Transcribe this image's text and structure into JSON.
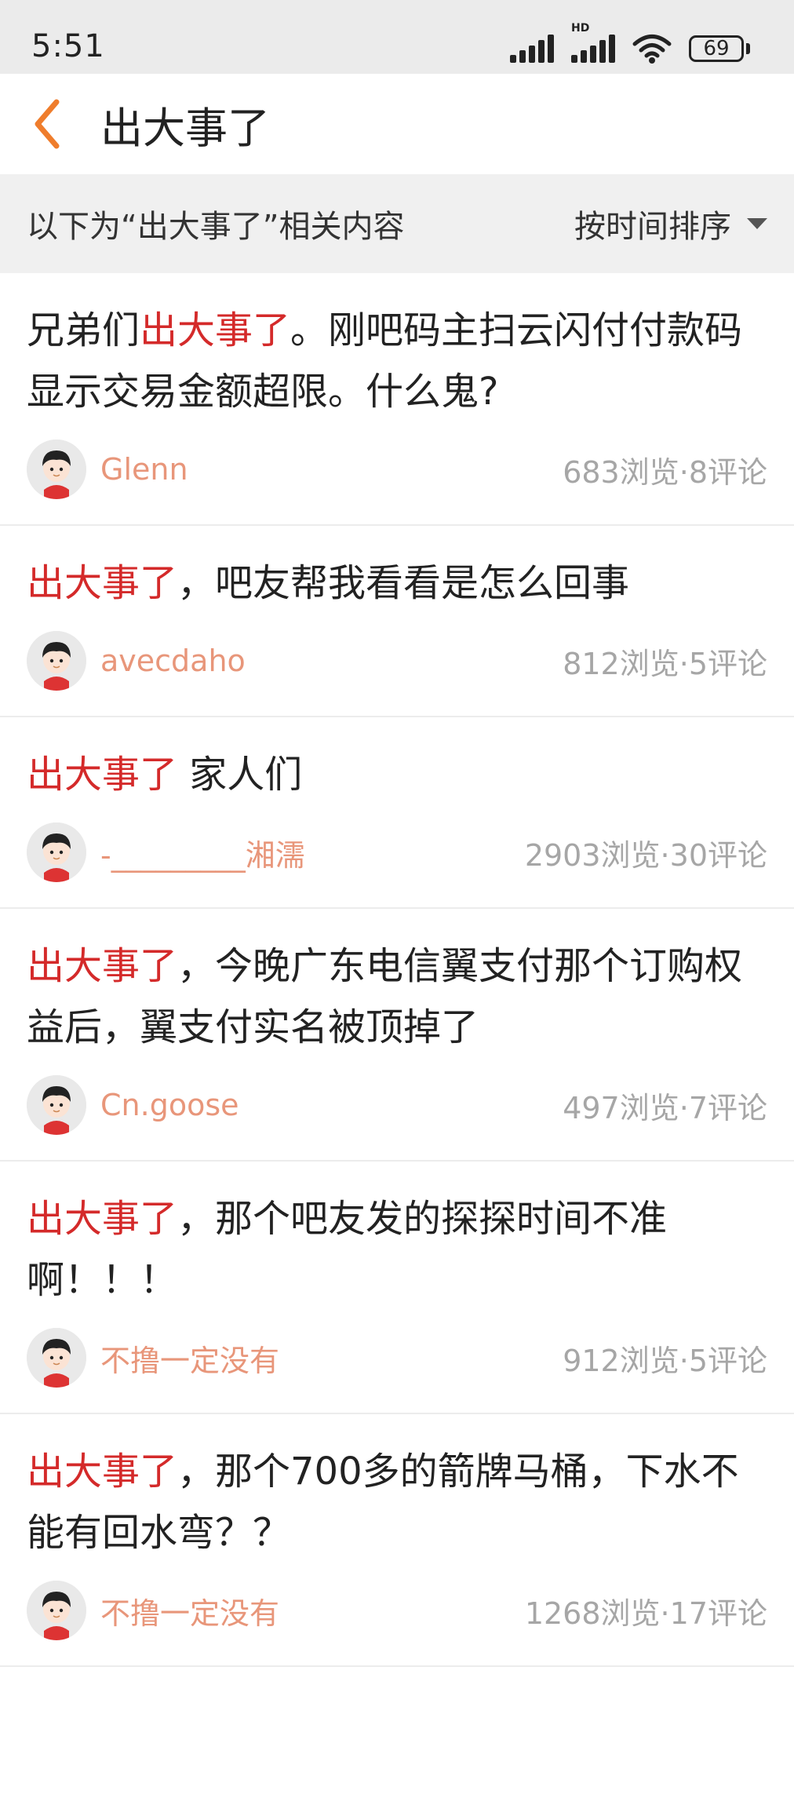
{
  "status_bar": {
    "time": "5:51",
    "battery": "69",
    "icons": [
      "signal-icon",
      "hd-signal-icon",
      "wifi-icon",
      "battery-icon"
    ]
  },
  "nav": {
    "title": "出大事了",
    "back_icon": "chevron-left-icon",
    "accent": "#ef7d2c"
  },
  "filter": {
    "label": "以下为“出大事了”相关内容",
    "sort_label": "按时间排序",
    "sort_icon": "caret-down-icon"
  },
  "keyword_color": "#d42a2a",
  "posts": [
    {
      "title_pre": "兄弟们",
      "keyword": "出大事了",
      "title_post": "。刚吧码主扫云闪付付款码 显示交易金额超限。什么鬼?",
      "author": "Glenn",
      "views": "683浏览",
      "comments": "8评论"
    },
    {
      "title_pre": "",
      "keyword": "出大事了",
      "title_post": "，吧友帮我看看是怎么回事",
      "author": "avecdaho",
      "views": "812浏览",
      "comments": "5评论"
    },
    {
      "title_pre": "",
      "keyword": "出大事了",
      "title_post": " 家人们",
      "author": "-_________湘濡",
      "views": "2903浏览",
      "comments": "30评论"
    },
    {
      "title_pre": "",
      "keyword": "出大事了",
      "title_post": "，今晚广东电信翼支付那个订购权益后，翼支付实名被顶掉了",
      "author": "Cn.goose",
      "views": "497浏览",
      "comments": "7评论"
    },
    {
      "title_pre": "",
      "keyword": "出大事了",
      "title_post": "，那个吧友发的探探时间不准啊！！！",
      "author": "不撸一定没有",
      "views": "912浏览",
      "comments": "5评论"
    },
    {
      "title_pre": "",
      "keyword": "出大事了",
      "title_post": "，那个700多的箭牌马桶，下水不能有回水弯？？",
      "author": "不撸一定没有",
      "views": "1268浏览",
      "comments": "17评论"
    }
  ]
}
